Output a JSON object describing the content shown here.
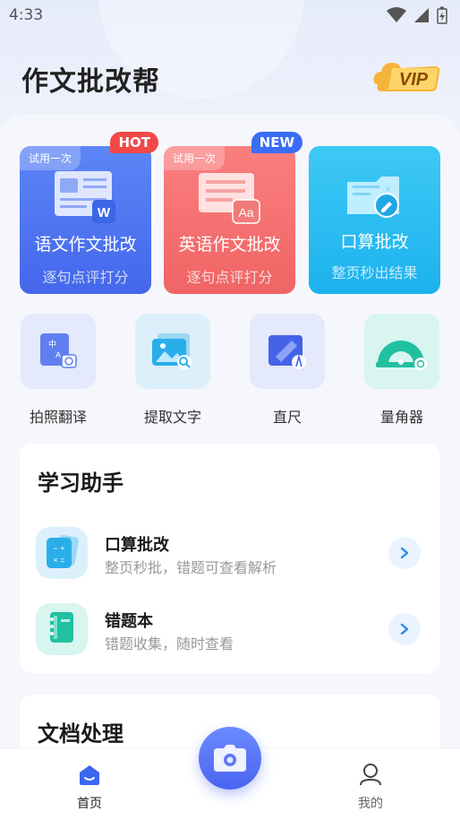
{
  "status": {
    "time": "4:33"
  },
  "header": {
    "title": "作文批改帮",
    "vip_label": "VIP"
  },
  "cards": [
    {
      "title": "语文作文批改",
      "subtitle": "逐句点评打分",
      "trial": "试用一次",
      "badge": "HOT",
      "badge_color": "#f24848"
    },
    {
      "title": "英语作文批改",
      "subtitle": "逐句点评打分",
      "trial": "试用一次",
      "badge": "NEW",
      "badge_color": "#3a6cf5"
    },
    {
      "title": "口算批改",
      "subtitle": "整页秒出结果"
    }
  ],
  "tools": [
    {
      "label": "拍照翻译",
      "icon": "photo-translate-icon"
    },
    {
      "label": "提取文字",
      "icon": "extract-text-icon"
    },
    {
      "label": "直尺",
      "icon": "ruler-icon"
    },
    {
      "label": "量角器",
      "icon": "protractor-icon"
    }
  ],
  "learning": {
    "title": "学习助手",
    "items": [
      {
        "title": "口算批改",
        "subtitle": "整页秒批，错题可查看解析",
        "icon": "calculator-icon"
      },
      {
        "title": "错题本",
        "subtitle": "错题收集，随时查看",
        "icon": "notebook-icon"
      }
    ]
  },
  "documents": {
    "title": "文档处理"
  },
  "nav": {
    "home": "首页",
    "mine": "我的"
  },
  "colors": {
    "accent": "#4a64f0",
    "hot": "#f24848",
    "new": "#3a6cf5"
  }
}
